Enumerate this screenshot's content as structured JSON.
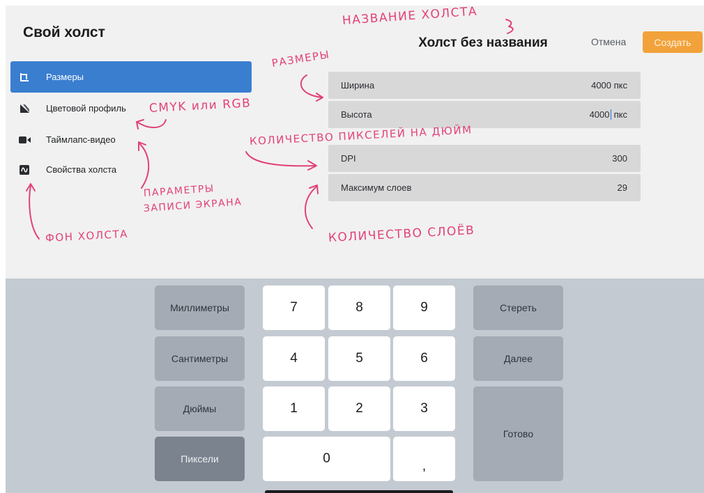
{
  "header": {
    "panel_title": "Свой холст",
    "canvas_title": "Холст без названия",
    "cancel_label": "Отмена",
    "create_label": "Создать"
  },
  "sidebar": {
    "items": [
      {
        "label": "Размеры",
        "icon": "dimensions-icon",
        "active": true
      },
      {
        "label": "Цветовой профиль",
        "icon": "color-profile-icon",
        "active": false
      },
      {
        "label": "Таймлапс-видео",
        "icon": "video-camera-icon",
        "active": false
      },
      {
        "label": "Свойства холста",
        "icon": "canvas-properties-icon",
        "active": false
      }
    ]
  },
  "fields": {
    "width": {
      "label": "Ширина",
      "value": "4000 пкс"
    },
    "height": {
      "label": "Высота",
      "value_before": "4000",
      "value_after": " пкс"
    },
    "dpi": {
      "label": "DPI",
      "value": "300"
    },
    "max_layers": {
      "label": "Максимум слоев",
      "value": "29"
    }
  },
  "annotations": {
    "canvas_name": "НАЗВАНИЕ ХОЛСТА",
    "sizes": "РАЗМЕРЫ",
    "cmyk_rgb": "CMYK или RGB",
    "ppi": "КОЛИЧЕСТВО ПИКСЕЛЕЙ НА ДЮЙМ",
    "screen_rec_1": "ПАРАМЕТРЫ",
    "screen_rec_2": "ЗАПИСИ ЭКРАНА",
    "background": "ФОН ХОЛСТА",
    "layers": "КОЛИЧЕСТВО СЛОЁВ"
  },
  "keyboard": {
    "units": [
      "Миллиметры",
      "Сантиметры",
      "Дюймы",
      "Пиксели"
    ],
    "selected_unit": "Пиксели",
    "digits": [
      "7",
      "8",
      "9",
      "4",
      "5",
      "6",
      "1",
      "2",
      "3",
      "0",
      ","
    ],
    "erase_label": "Стереть",
    "next_label": "Далее",
    "done_label": "Готово"
  },
  "colors": {
    "accent": "#3a7ed0",
    "create_button": "#f2a23b",
    "annotation": "#e2417a"
  }
}
